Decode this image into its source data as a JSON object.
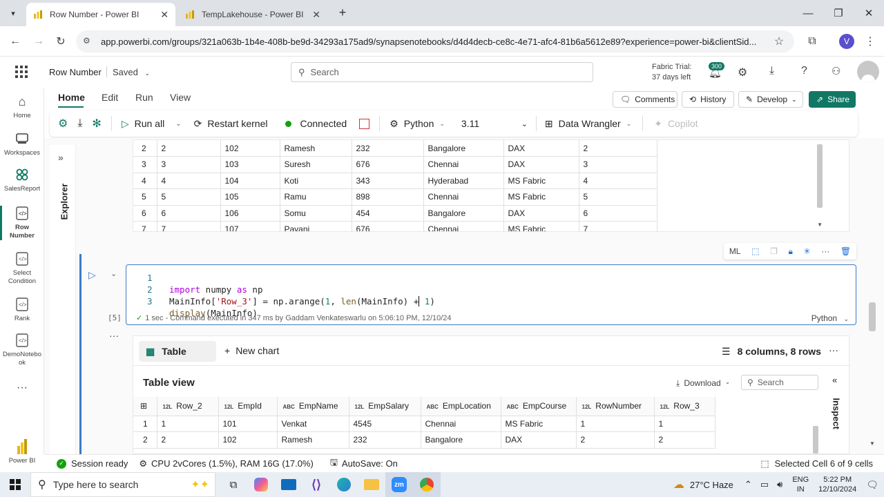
{
  "browser": {
    "tabs": [
      {
        "title": "Row Number - Power BI",
        "active": true
      },
      {
        "title": "TempLakehouse - Power BI",
        "active": false
      }
    ],
    "url": "app.powerbi.com/groups/321a063b-1b4e-408b-be9d-34293a175ad9/synapsenotebooks/d4d4decb-ce8c-4e71-afc4-81b6a5612e89?experience=power-bi&clientSid..."
  },
  "header": {
    "notebook_name": "Row Number",
    "saved": "Saved",
    "search_placeholder": "Search",
    "trial_line1": "Fabric Trial:",
    "trial_line2": "37 days left",
    "notif_count": "300",
    "avatar_letter": "V"
  },
  "rail": [
    {
      "label": "Home"
    },
    {
      "label": "Workspaces"
    },
    {
      "label": "SalesReport"
    },
    {
      "label": "Row Number"
    },
    {
      "label": "Select Condition"
    },
    {
      "label": "Rank"
    },
    {
      "label": "DemoNotebook"
    },
    {
      "label": "Power BI"
    }
  ],
  "ribbon": {
    "tabs": [
      "Home",
      "Edit",
      "Run",
      "View"
    ],
    "comments": "Comments",
    "history": "History",
    "develop": "Develop",
    "share": "Share"
  },
  "toolbar": {
    "run_all": "Run all",
    "restart_kernel": "Restart kernel",
    "connected": "Connected",
    "language": "Python",
    "version": "3.11",
    "data_wrangler": "Data Wrangler",
    "copilot": "Copilot"
  },
  "explorer_label": "Explorer",
  "prev_output": {
    "rows": [
      [
        "2",
        "2",
        "102",
        "Ramesh",
        "232",
        "Bangalore",
        "DAX",
        "2"
      ],
      [
        "3",
        "3",
        "103",
        "Suresh",
        "676",
        "Chennai",
        "DAX",
        "3"
      ],
      [
        "4",
        "4",
        "104",
        "Koti",
        "343",
        "Hyderabad",
        "MS Fabric",
        "4"
      ],
      [
        "5",
        "5",
        "105",
        "Ramu",
        "898",
        "Chennai",
        "MS Fabric",
        "5"
      ],
      [
        "6",
        "6",
        "106",
        "Somu",
        "454",
        "Bangalore",
        "DAX",
        "6"
      ],
      [
        "7",
        "7",
        "107",
        "Pavani",
        "676",
        "Chennai",
        "MS Fabric",
        "7"
      ]
    ]
  },
  "cell": {
    "line_numbers": [
      "1",
      "2",
      "3"
    ],
    "exec_count": "[5]",
    "status": "1 sec - Command executed in 347 ms by Gaddam Venkateswarlu on 5:06:10 PM, 12/10/24",
    "language": "Python",
    "cell_toolbar_ml": "ML"
  },
  "output": {
    "tab_table": "Table",
    "tab_new_chart": "New chart",
    "summary": "8 columns, 8 rows",
    "table_view": "Table view",
    "download": "Download",
    "search_placeholder": "Search",
    "inspect": "Inspect",
    "columns": [
      {
        "type": "12L",
        "name": "Row_2"
      },
      {
        "type": "12L",
        "name": "EmpId"
      },
      {
        "type": "ABC",
        "name": "EmpName"
      },
      {
        "type": "12L",
        "name": "EmpSalary"
      },
      {
        "type": "ABC",
        "name": "EmpLocation"
      },
      {
        "type": "ABC",
        "name": "EmpCourse"
      },
      {
        "type": "12L",
        "name": "RowNumber"
      },
      {
        "type": "12L",
        "name": "Row_3"
      }
    ],
    "rows": [
      [
        "1",
        "1",
        "101",
        "Venkat",
        "4545",
        "Chennai",
        "MS Fabric",
        "1",
        "1"
      ],
      [
        "2",
        "2",
        "102",
        "Ramesh",
        "232",
        "Bangalore",
        "DAX",
        "2",
        "2"
      ]
    ]
  },
  "status": {
    "session": "Session ready",
    "cpu": "CPU 2vCores (1.5%), RAM 16G (17.0%)",
    "autosave": "AutoSave: On",
    "selected": "Selected Cell 6 of 9 cells"
  },
  "taskbar": {
    "search_placeholder": "Type here to search",
    "weather": "27°C  Haze",
    "lang1": "ENG",
    "lang2": "IN",
    "time": "5:22 PM",
    "date": "12/10/2024"
  },
  "colors": {
    "accent": "#117865",
    "cell_border": "#3b7cc4",
    "connected": "#13a10e"
  }
}
